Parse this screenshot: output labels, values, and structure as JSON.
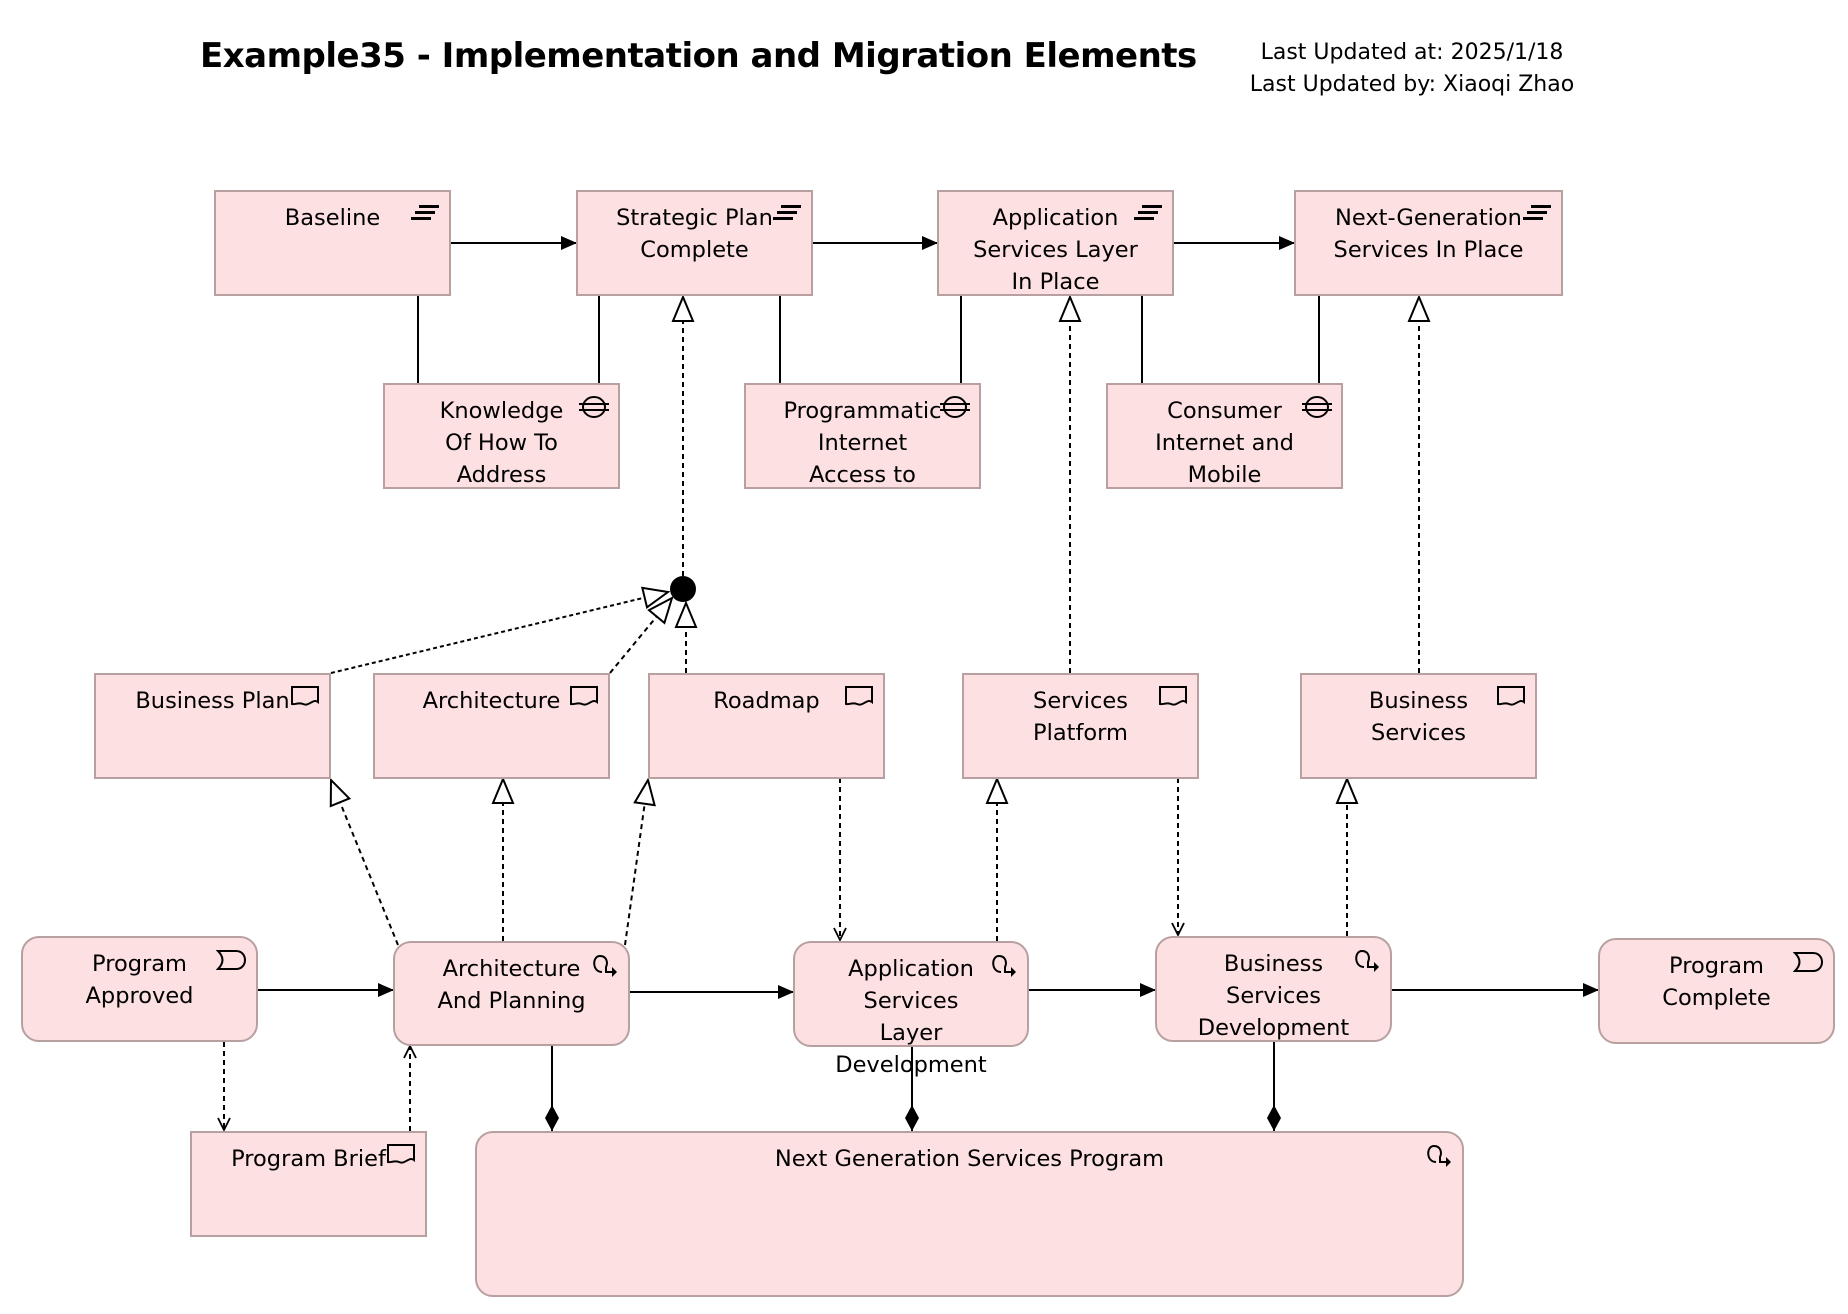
{
  "header": {
    "title": "Example35 - Implementation and Migration Elements",
    "last_updated_at": "Last Updated at: 2025/1/18",
    "last_updated_by": "Last Updated by: Xiaoqi Zhao"
  },
  "colors": {
    "element_fill": "#fde0e2",
    "element_border": "#b8a0a0",
    "line": "#000000"
  },
  "nodes": {
    "baseline": {
      "label": "Baseline",
      "type": "plateau",
      "icon": "plateau-icon"
    },
    "strategic_plan_complete": {
      "label": "Strategic Plan\nComplete",
      "type": "plateau",
      "icon": "plateau-icon"
    },
    "app_services_layer_in_place": {
      "label": "Application\nServices Layer\nIn Place",
      "type": "plateau",
      "icon": "plateau-icon"
    },
    "next_gen_services_in_place": {
      "label": "Next-Generation\nServices In Place",
      "type": "plateau",
      "icon": "plateau-icon"
    },
    "knowledge_gap": {
      "label": "Knowledge\nOf How To\nAddress",
      "type": "gap",
      "icon": "gap-icon"
    },
    "programmatic_internet_gap": {
      "label": "Programmatic\nInternet\nAccess to",
      "type": "gap",
      "icon": "gap-icon"
    },
    "consumer_internet_gap": {
      "label": "Consumer\nInternet and\nMobile",
      "type": "gap",
      "icon": "gap-icon"
    },
    "business_plan": {
      "label": "Business Plan",
      "type": "deliverable",
      "icon": "deliverable-icon"
    },
    "architecture": {
      "label": "Architecture",
      "type": "deliverable",
      "icon": "deliverable-icon"
    },
    "roadmap": {
      "label": "Roadmap",
      "type": "deliverable",
      "icon": "deliverable-icon"
    },
    "services_platform": {
      "label": "Services\nPlatform",
      "type": "deliverable",
      "icon": "deliverable-icon"
    },
    "business_services": {
      "label": "Business\nServices",
      "type": "deliverable",
      "icon": "deliverable-icon"
    },
    "program_approved": {
      "label": "Program\nApproved",
      "type": "implementation-event",
      "icon": "event-icon"
    },
    "architecture_and_planning": {
      "label": "Architecture\nAnd Planning",
      "type": "work-package",
      "icon": "work-package-icon"
    },
    "app_services_layer_dev": {
      "label": "Application\nServices Layer\nDevelopment",
      "type": "work-package",
      "icon": "work-package-icon"
    },
    "business_services_dev": {
      "label": "Business\nServices\nDevelopment",
      "type": "work-package",
      "icon": "work-package-icon"
    },
    "program_complete": {
      "label": "Program\nComplete",
      "type": "implementation-event",
      "icon": "event-icon"
    },
    "program_brief": {
      "label": "Program Brief",
      "type": "deliverable",
      "icon": "deliverable-icon"
    },
    "next_gen_services_program": {
      "label": "Next Generation Services Program",
      "type": "work-package",
      "icon": "work-package-icon"
    }
  },
  "relationships": [
    {
      "from": "baseline",
      "to": "strategic_plan_complete",
      "type": "triggering"
    },
    {
      "from": "strategic_plan_complete",
      "to": "app_services_layer_in_place",
      "type": "triggering"
    },
    {
      "from": "app_services_layer_in_place",
      "to": "next_gen_services_in_place",
      "type": "triggering"
    },
    {
      "from": "baseline",
      "to": "knowledge_gap",
      "type": "association"
    },
    {
      "from": "strategic_plan_complete",
      "to": "knowledge_gap",
      "type": "association"
    },
    {
      "from": "strategic_plan_complete",
      "to": "programmatic_internet_gap",
      "type": "association"
    },
    {
      "from": "app_services_layer_in_place",
      "to": "programmatic_internet_gap",
      "type": "association"
    },
    {
      "from": "app_services_layer_in_place",
      "to": "consumer_internet_gap",
      "type": "association"
    },
    {
      "from": "next_gen_services_in_place",
      "to": "consumer_internet_gap",
      "type": "association"
    },
    {
      "from": "junction",
      "to": "strategic_plan_complete",
      "type": "realization"
    },
    {
      "from": "business_plan",
      "to": "junction",
      "type": "realization"
    },
    {
      "from": "architecture",
      "to": "junction",
      "type": "realization"
    },
    {
      "from": "roadmap",
      "to": "junction",
      "type": "realization"
    },
    {
      "from": "services_platform",
      "to": "app_services_layer_in_place",
      "type": "realization"
    },
    {
      "from": "business_services",
      "to": "next_gen_services_in_place",
      "type": "realization"
    },
    {
      "from": "architecture_and_planning",
      "to": "business_plan",
      "type": "realization"
    },
    {
      "from": "architecture_and_planning",
      "to": "architecture",
      "type": "realization"
    },
    {
      "from": "architecture_and_planning",
      "to": "roadmap",
      "type": "realization"
    },
    {
      "from": "roadmap",
      "to": "app_services_layer_dev",
      "type": "access"
    },
    {
      "from": "app_services_layer_dev",
      "to": "services_platform",
      "type": "realization"
    },
    {
      "from": "services_platform",
      "to": "business_services_dev",
      "type": "access"
    },
    {
      "from": "business_services_dev",
      "to": "business_services",
      "type": "realization"
    },
    {
      "from": "program_approved",
      "to": "architecture_and_planning",
      "type": "triggering"
    },
    {
      "from": "architecture_and_planning",
      "to": "app_services_layer_dev",
      "type": "triggering"
    },
    {
      "from": "app_services_layer_dev",
      "to": "business_services_dev",
      "type": "triggering"
    },
    {
      "from": "business_services_dev",
      "to": "program_complete",
      "type": "triggering"
    },
    {
      "from": "program_approved",
      "to": "program_brief",
      "type": "access"
    },
    {
      "from": "program_brief",
      "to": "architecture_and_planning",
      "type": "access"
    },
    {
      "from": "next_gen_services_program",
      "to": "architecture_and_planning",
      "type": "composition"
    },
    {
      "from": "next_gen_services_program",
      "to": "app_services_layer_dev",
      "type": "composition"
    },
    {
      "from": "next_gen_services_program",
      "to": "business_services_dev",
      "type": "composition"
    }
  ]
}
